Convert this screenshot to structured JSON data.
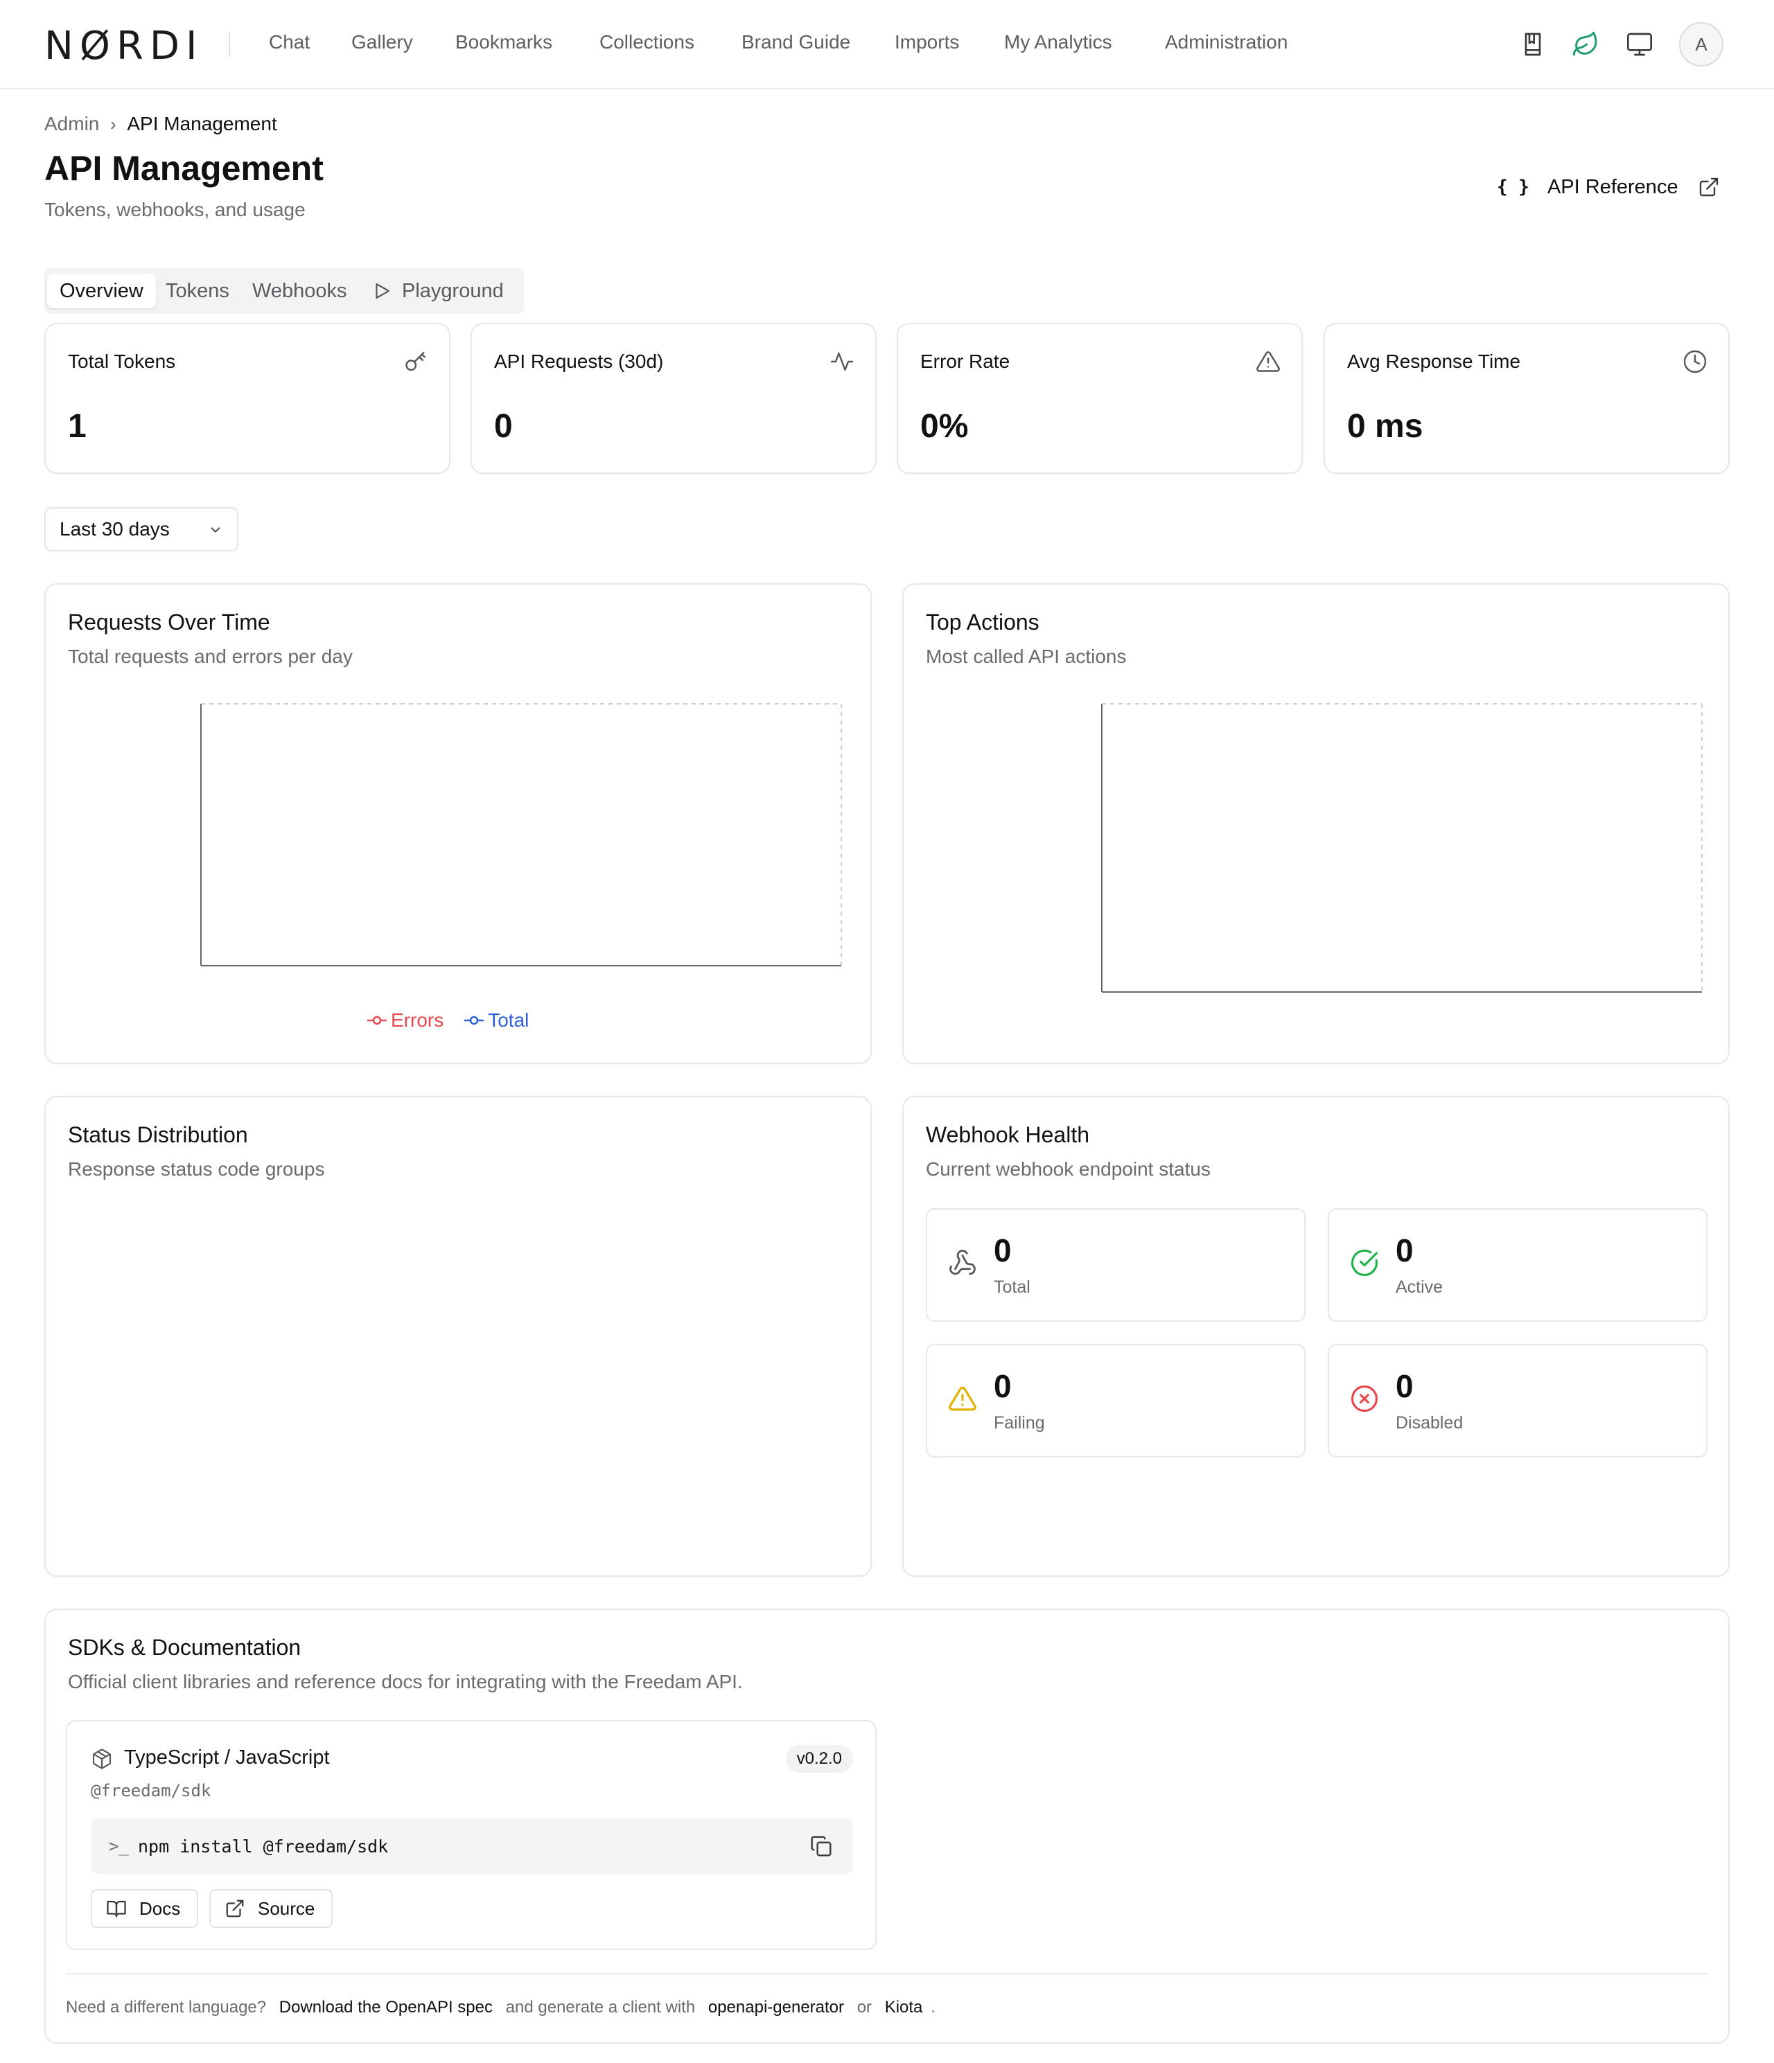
{
  "app": {
    "logo": "NØRDI",
    "avatar_initial": "A"
  },
  "nav": {
    "items": [
      "Chat",
      "Gallery",
      "Bookmarks",
      "Collections",
      "Brand Guide",
      "Imports",
      "My Analytics",
      "Administration"
    ],
    "icons": [
      "bookmark-book-icon",
      "leaf-icon",
      "monitor-icon"
    ]
  },
  "breadcrumb": {
    "parent": "Admin",
    "current": "API Management"
  },
  "page": {
    "title": "API Management",
    "subtitle": "Tokens, webhooks, and usage",
    "api_reference": "API Reference"
  },
  "tabs": [
    "Overview",
    "Tokens",
    "Webhooks",
    "Playground"
  ],
  "active_tab": "Overview",
  "stats": [
    {
      "label": "Total Tokens",
      "value": "1",
      "icon": "key-icon"
    },
    {
      "label": "API Requests (30d)",
      "value": "0",
      "icon": "activity-icon"
    },
    {
      "label": "Error Rate",
      "value": "0%",
      "icon": "warning-icon"
    },
    {
      "label": "Avg Response Time",
      "value": "0 ms",
      "icon": "clock-icon"
    }
  ],
  "range_select": {
    "value": "Last 30 days"
  },
  "requests_chart": {
    "title": "Requests Over Time",
    "subtitle": "Total requests and errors per day",
    "legend": [
      {
        "name": "Errors",
        "color": "#e5484d"
      },
      {
        "name": "Total",
        "color": "#2f5fd8"
      }
    ]
  },
  "top_actions": {
    "title": "Top Actions",
    "subtitle": "Most called API actions"
  },
  "status_distribution": {
    "title": "Status Distribution",
    "subtitle": "Response status code groups"
  },
  "webhook_health": {
    "title": "Webhook Health",
    "subtitle": "Current webhook endpoint status",
    "items": [
      {
        "value": "0",
        "label": "Total",
        "icon": "webhook-icon"
      },
      {
        "value": "0",
        "label": "Active",
        "icon": "check-circle-icon"
      },
      {
        "value": "0",
        "label": "Failing",
        "icon": "warning-icon"
      },
      {
        "value": "0",
        "label": "Disabled",
        "icon": "x-circle-icon"
      }
    ]
  },
  "sdks": {
    "title": "SDKs & Documentation",
    "subtitle": "Official client libraries and reference docs for integrating with the Freedam API.",
    "sdk": {
      "name": "TypeScript / JavaScript",
      "package": "@freedam/sdk",
      "version": "v0.2.0",
      "install_cmd": "npm install @freedam/sdk",
      "docs_label": "Docs",
      "source_label": "Source"
    },
    "footnote": {
      "prefix": "Need a different language?",
      "link1": "Download the OpenAPI spec",
      "middle": "and generate a client with",
      "link2": "openapi-generator",
      "or": "or",
      "link3": "Kiota",
      "end": "."
    }
  },
  "chart_data": [
    {
      "type": "line",
      "title": "Requests Over Time",
      "series": [
        {
          "name": "Errors",
          "values": []
        },
        {
          "name": "Total",
          "values": []
        }
      ],
      "x": []
    },
    {
      "type": "bar",
      "title": "Top Actions",
      "categories": [],
      "values": []
    }
  ]
}
